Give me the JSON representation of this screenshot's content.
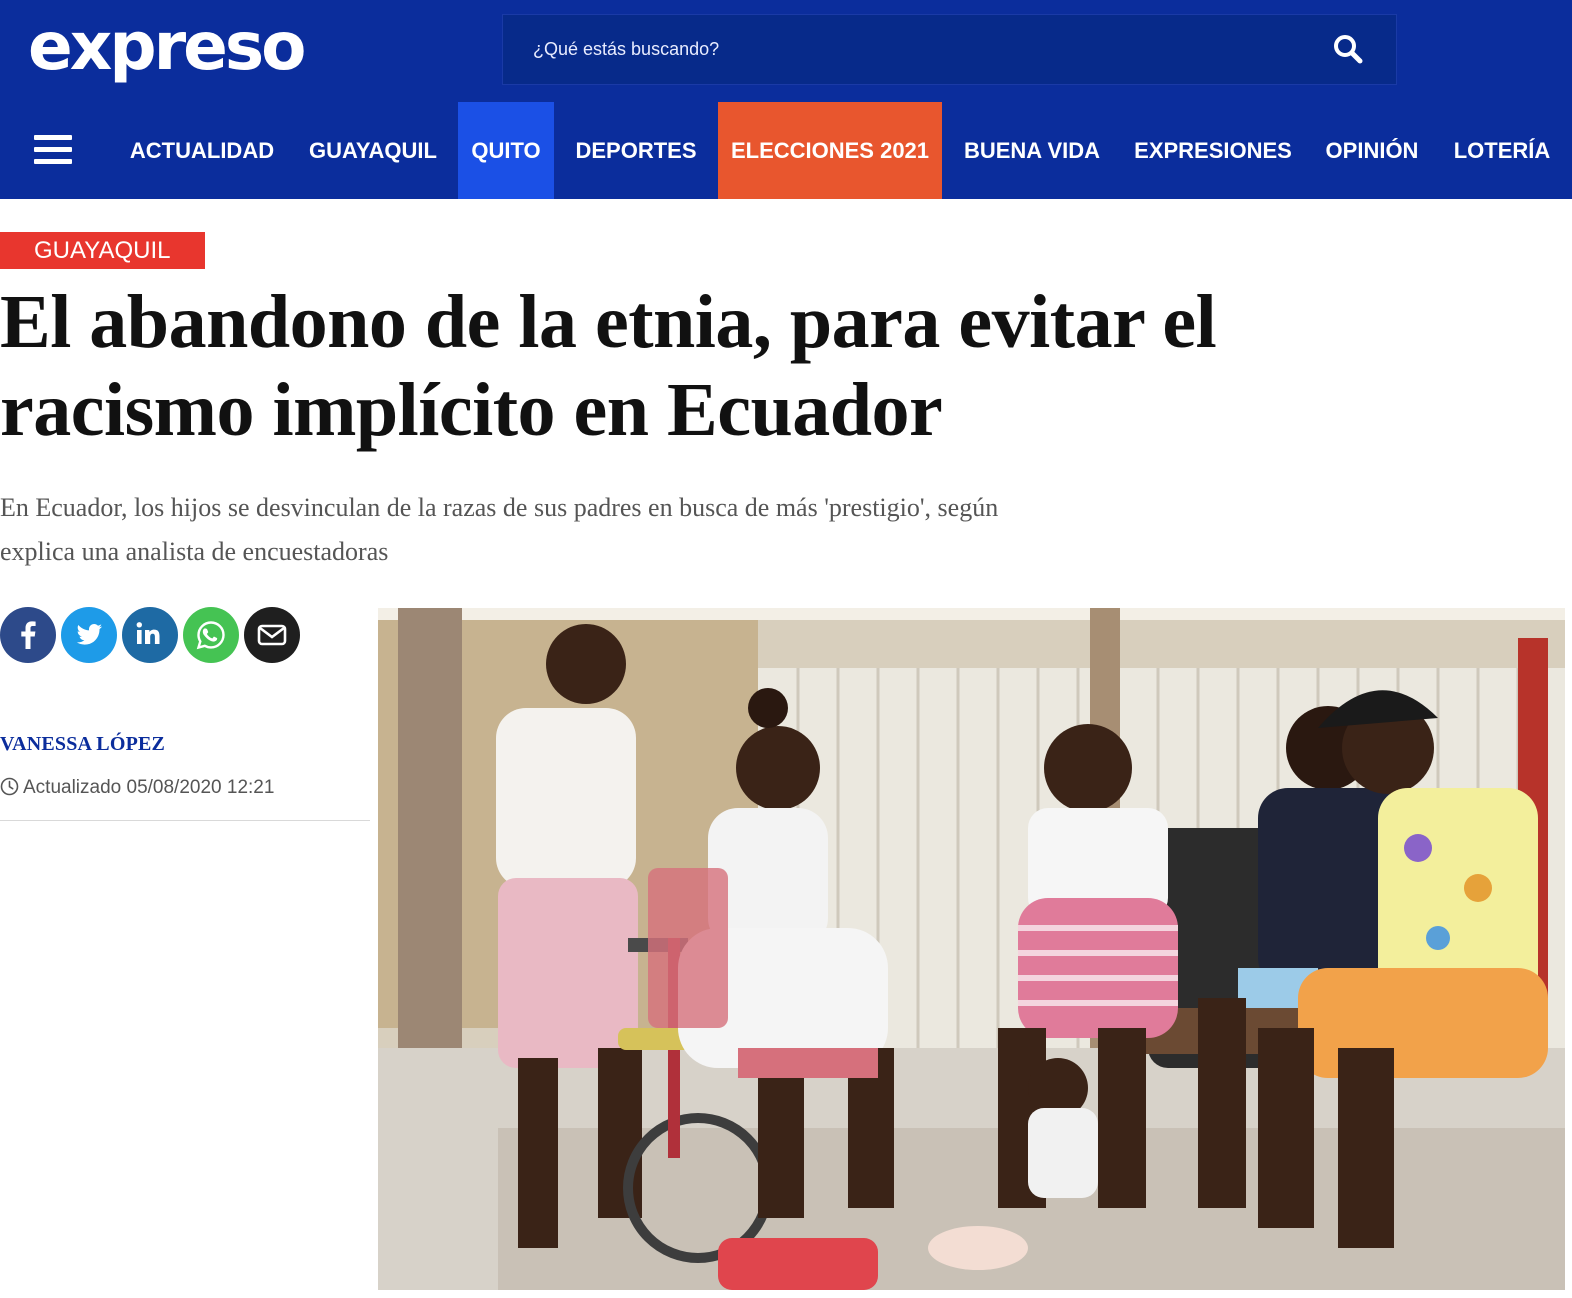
{
  "header": {
    "logo": "expreso",
    "search_placeholder": "¿Qué estás buscando?"
  },
  "nav": {
    "items": [
      {
        "label": "ACTUALIDAD"
      },
      {
        "label": "GUAYAQUIL"
      },
      {
        "label": "QUITO",
        "highlight": "#1b50e6"
      },
      {
        "label": "DEPORTES"
      },
      {
        "label": "ELECCIONES 2021",
        "highlight": "#e8562e"
      },
      {
        "label": "BUENA VIDA"
      },
      {
        "label": "EXPRESIONES"
      },
      {
        "label": "OPINIÓN"
      },
      {
        "label": "LOTERÍA"
      }
    ]
  },
  "article": {
    "section": "GUAYAQUIL",
    "title_line1": "El abandono de la etnia, para evitar el",
    "title_line2": "racismo implícito en Ecuador",
    "subtitle_line1": "En Ecuador, los hijos se desvinculan de la razas de sus padres en busca de más 'prestigio', según",
    "subtitle_line2": "explica una analista de encuestadoras",
    "author": "VANESSA LÓPEZ",
    "updated": "Actualizado 05/08/2020 12:21",
    "share": [
      {
        "name": "facebook",
        "color": "#2d4a8a"
      },
      {
        "name": "twitter",
        "color": "#1e9be8"
      },
      {
        "name": "linkedin",
        "color": "#1e6aa4"
      },
      {
        "name": "whatsapp",
        "color": "#45c353"
      },
      {
        "name": "email",
        "color": "#1f1f1f"
      }
    ]
  },
  "colors": {
    "brand": "#0b2d9c",
    "section_tag": "#e8362e",
    "byline": "#0b2d9c"
  }
}
